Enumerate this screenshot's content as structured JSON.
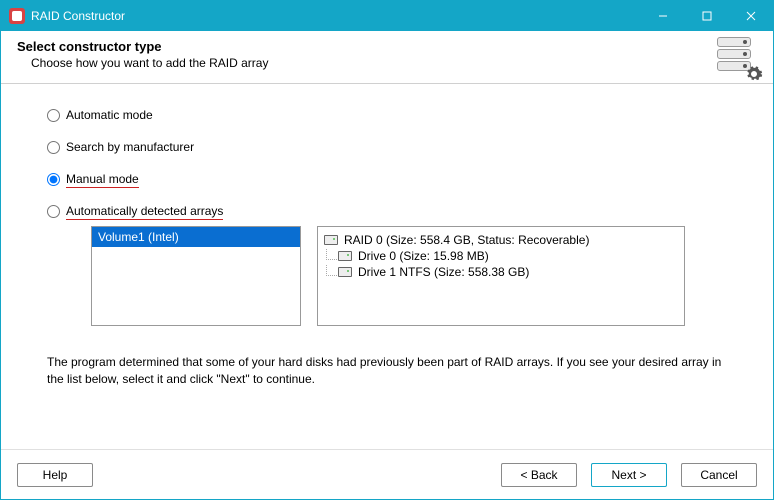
{
  "titlebar": {
    "title": "RAID Constructor"
  },
  "header": {
    "title": "Select constructor type",
    "subtitle": "Choose how you want to add the RAID array"
  },
  "radios": {
    "auto": "Automatic mode",
    "manufacturer": "Search by manufacturer",
    "manual": "Manual mode",
    "detected": "Automatically detected arrays"
  },
  "selected_array": "Volume1 (Intel)",
  "tree": {
    "root": "RAID 0 (Size: 558.4 GB, Status: Recoverable)",
    "child0": "Drive 0 (Size: 15.98 MB)",
    "child1": "Drive 1 NTFS (Size: 558.38 GB)"
  },
  "hint": "The program determined that some of your hard disks had previously been part of RAID arrays. If you see your desired array in the list below, select it and click \"Next\" to continue.",
  "footer": {
    "help": "Help",
    "back": "< Back",
    "next": "Next >",
    "cancel": "Cancel"
  }
}
